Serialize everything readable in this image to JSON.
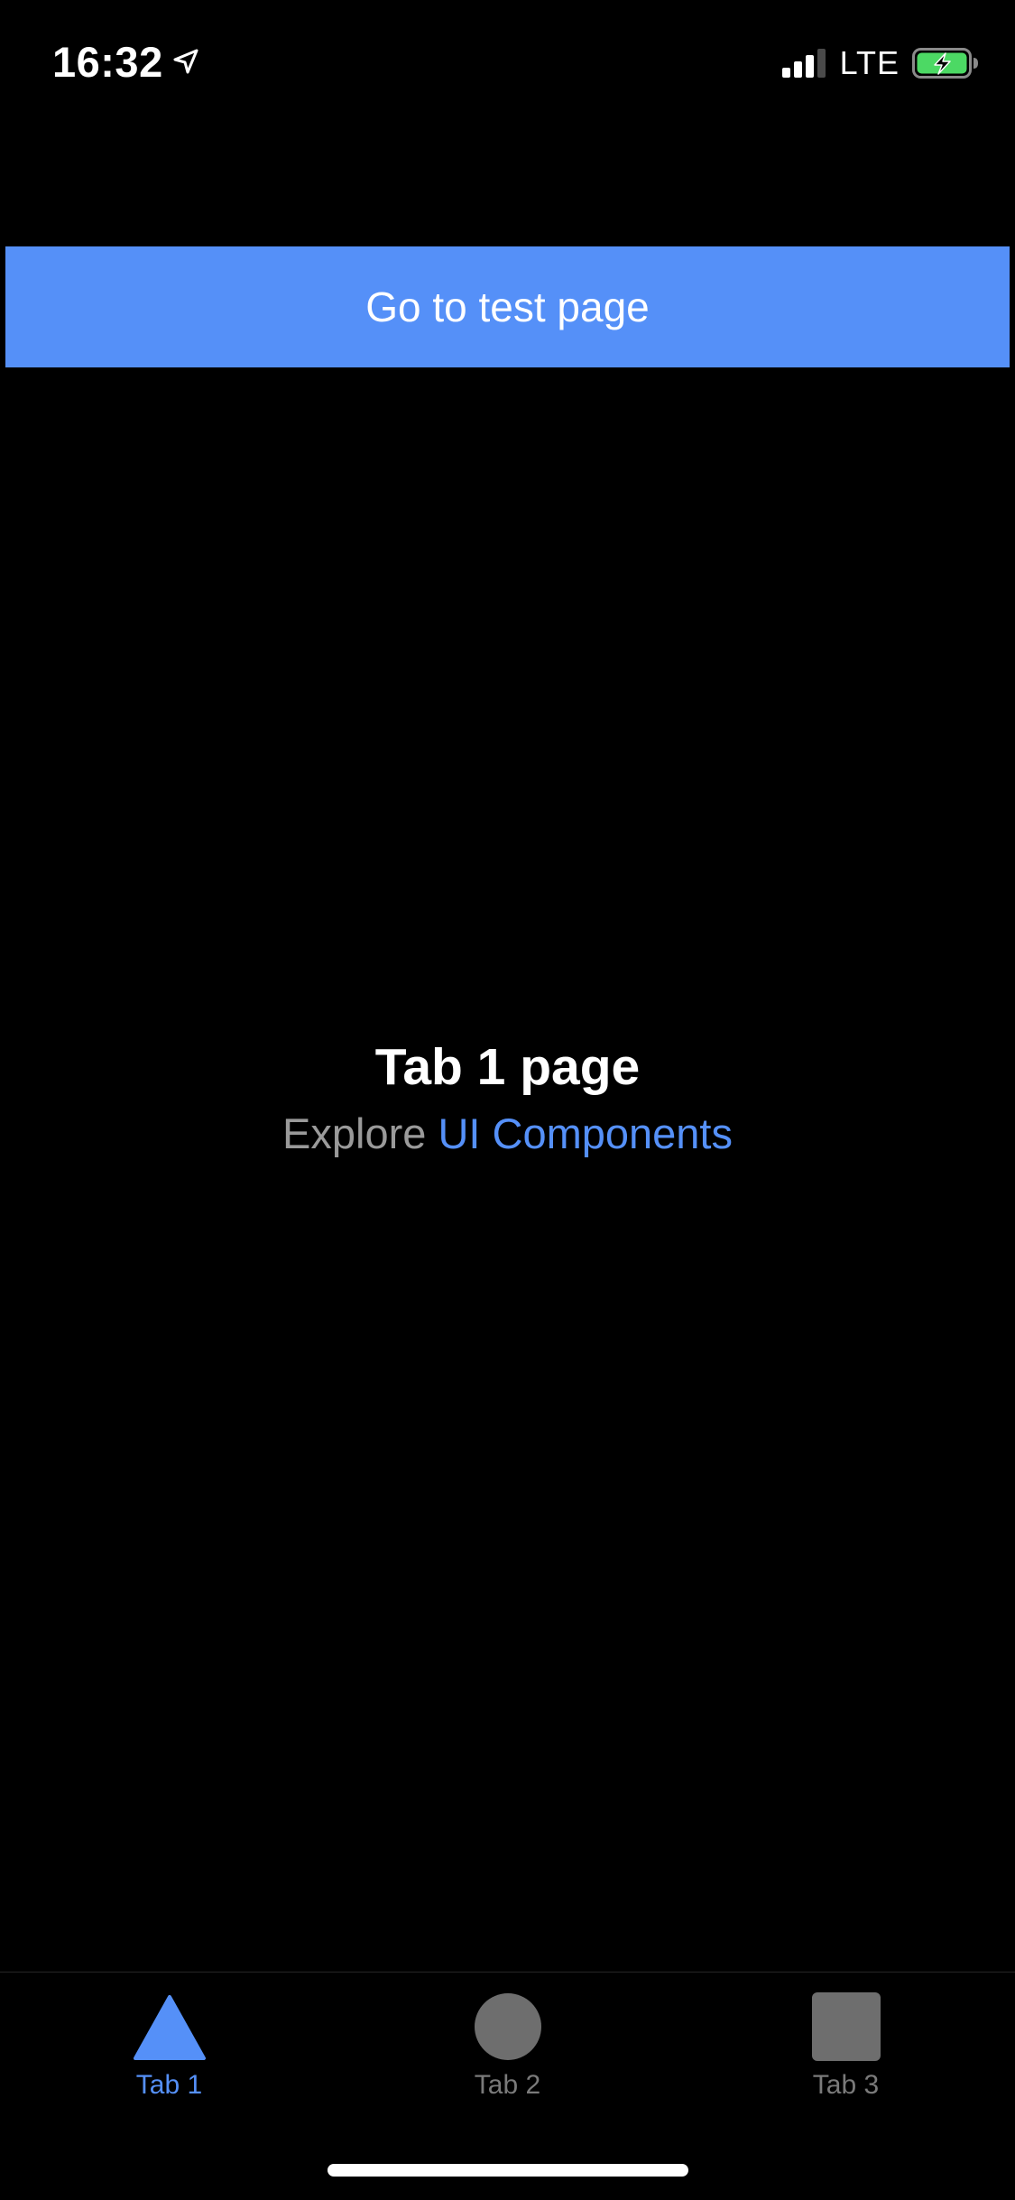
{
  "status_bar": {
    "time": "16:32",
    "network": "LTE",
    "location_icon": "location-arrow-icon",
    "signal_icon": "cellular-signal-icon",
    "battery_icon": "battery-charging-icon",
    "battery_color": "#4cd964"
  },
  "header": {
    "button_label": "Go to test page",
    "button_color": "#5590f8"
  },
  "main": {
    "title": "Tab 1 page",
    "subtitle_prefix": "Explore",
    "subtitle_link": "UI Components"
  },
  "tab_bar": {
    "active_color": "#5590f8",
    "inactive_color": "#6e6e6e",
    "tabs": [
      {
        "label": "Tab 1",
        "icon": "triangle-icon",
        "active": true
      },
      {
        "label": "Tab 2",
        "icon": "circle-icon",
        "active": false
      },
      {
        "label": "Tab 3",
        "icon": "square-icon",
        "active": false
      }
    ]
  }
}
